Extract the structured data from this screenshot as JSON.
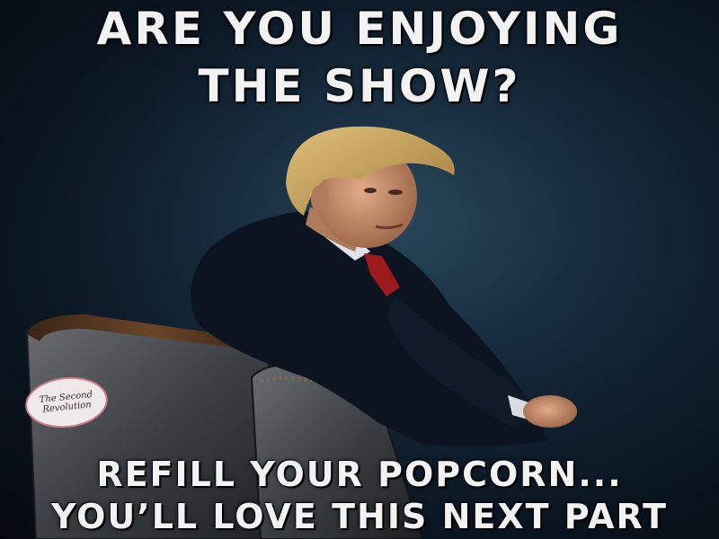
{
  "captions": {
    "top_line_1": "ARE YOU ENJOYING",
    "top_line_2": "THE SHOW?",
    "bottom_line_1": "REFILL YOUR POPCORN...",
    "bottom_line_2": "YOU’LL LOVE THIS NEXT PART"
  },
  "watermark": {
    "text": "The Second Revolution"
  },
  "colors": {
    "background": "#14283a",
    "caption_text": "#f2f2f2",
    "suit": "#0c1420",
    "tie": "#9a1a1e",
    "hair": "#c9a35f",
    "skin": "#d49a78",
    "chair_leather": "#4a4e52",
    "chair_wood": "#5a3a22"
  }
}
